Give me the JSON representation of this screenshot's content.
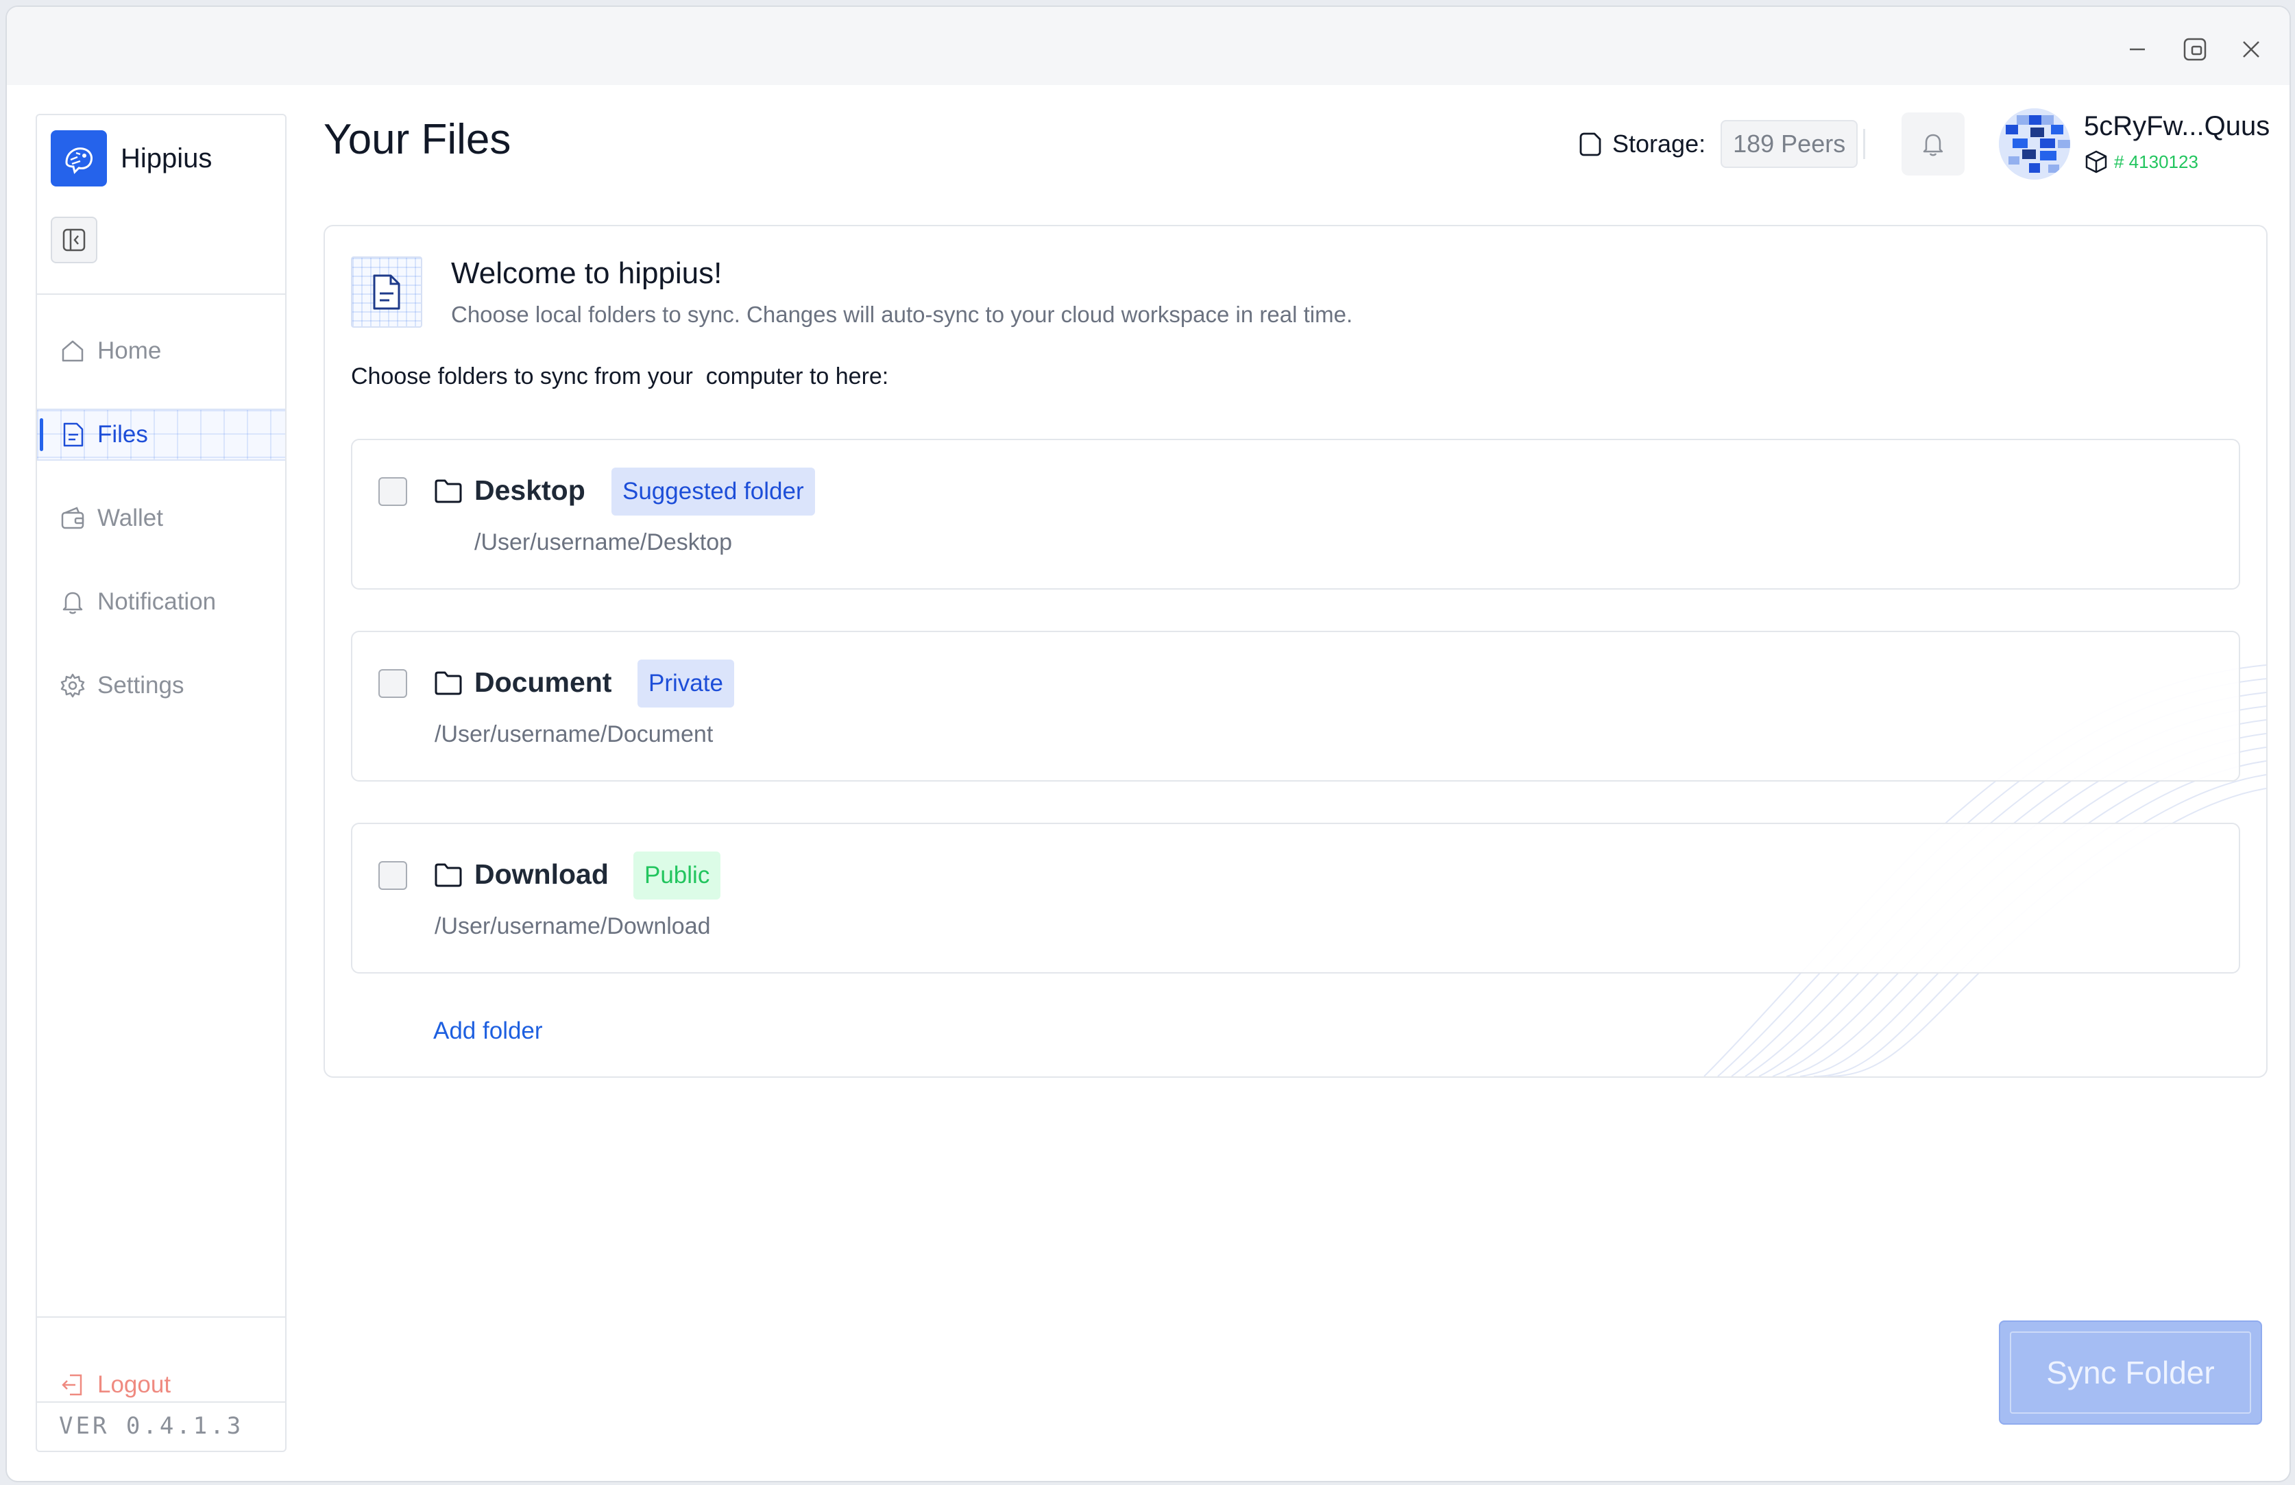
{
  "window": {
    "controls": [
      "minimize-icon",
      "restore-icon",
      "close-icon"
    ]
  },
  "sidebar": {
    "brand": "Hippius",
    "items": [
      {
        "label": "Home",
        "icon": "home-icon",
        "active": false
      },
      {
        "label": "Files",
        "icon": "file-icon",
        "active": true
      },
      {
        "label": "Wallet",
        "icon": "wallet-icon",
        "active": false
      },
      {
        "label": "Notification",
        "icon": "bell-icon",
        "active": false
      },
      {
        "label": "Settings",
        "icon": "gear-icon",
        "active": false
      }
    ],
    "logout": "Logout",
    "version": "VER 0.4.1.3"
  },
  "header": {
    "title": "Your Files",
    "storage_label": "Storage:",
    "peers": "189 Peers",
    "account_name": "5cRyFw...Quus",
    "block_number": "# 4130123"
  },
  "welcome": {
    "title": "Welcome to hippius!",
    "subtitle": "Choose local folders to sync. Changes will auto-sync to your cloud workspace in real time.",
    "choose_text": "Choose folders to sync from your  computer to here:"
  },
  "folders": [
    {
      "name": "Desktop",
      "badge": "Suggested folder",
      "badge_color": "#1d4ed8",
      "path": "/User/username/Desktop",
      "checked": false
    },
    {
      "name": "Document",
      "badge": "Private",
      "badge_color": "#1d4ed8",
      "path": "/User/username/Document",
      "checked": false
    },
    {
      "name": "Download",
      "badge": "Public",
      "badge_color": "#22c55e",
      "path": "/User/username/Download",
      "checked": false
    }
  ],
  "add_folder": "Add folder",
  "sync_button": "Sync Folder",
  "colors": {
    "accent": "#2563eb",
    "success": "#22c55e",
    "danger": "#ef8a80"
  }
}
